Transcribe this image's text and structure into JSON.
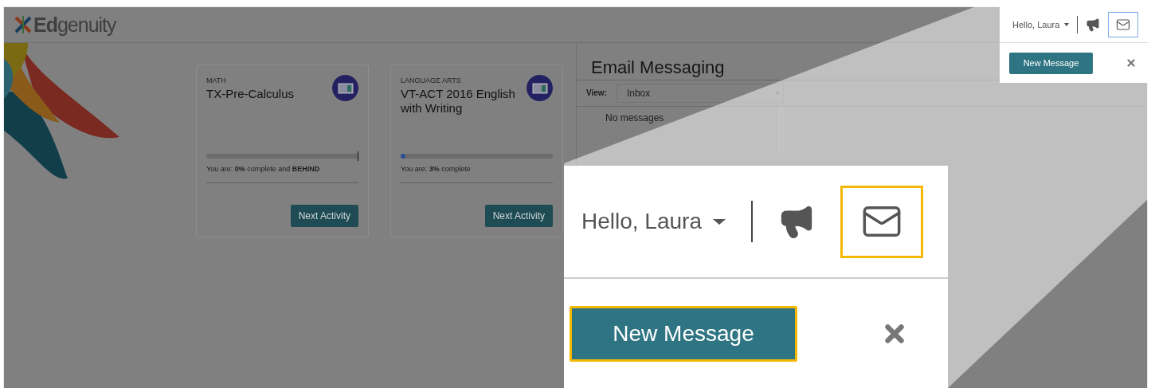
{
  "header": {
    "logo": "**Ed**genuity"
  },
  "courses": [
    {
      "subject": "MATH",
      "title": "TX-Pre-Calculus",
      "level": 0,
      "target_marker": true,
      "status": "You are: **0%** complete and **BEHIND**",
      "button": "Next Activity"
    },
    {
      "subject": "LANGUAGE ARTS",
      "title": "VT-ACT 2016 English with Writing",
      "level": 0.03,
      "target_marker": false,
      "status": "You are: **3%** complete",
      "button": "Next Activity"
    }
  ],
  "email": {
    "title": "Email Messaging",
    "view_label": "View:",
    "view_value": "Inbox",
    "empty": "No messages"
  },
  "user_menu": {
    "greeting": "Hello, Laura",
    "mail_selected": true,
    "new_message": "New Message"
  },
  "callout": {
    "greeting": "Hello, Laura",
    "highlighted": true,
    "new_message": "New Message"
  }
}
